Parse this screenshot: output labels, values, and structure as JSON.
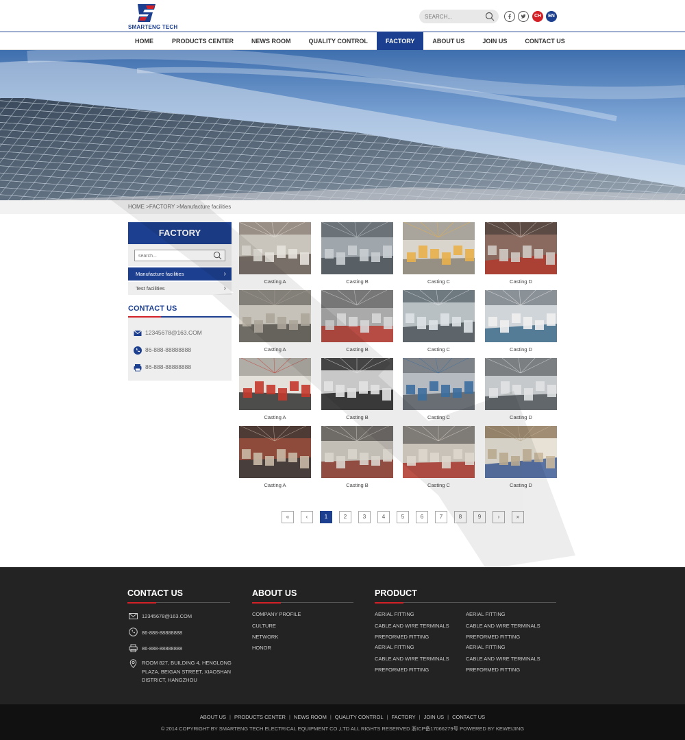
{
  "header": {
    "logo_text": "SMARTENG TECH",
    "search_placeholder": "SEARCH...",
    "lang_ch": "CH",
    "lang_en": "EN"
  },
  "nav": {
    "items": [
      "HOME",
      "PRODUCTS CENTER",
      "NEWS ROOM",
      "QUALITY CONTROL",
      "FACTORY",
      "ABOUT US",
      "JOIN US",
      "CONTACT US"
    ],
    "active": "FACTORY"
  },
  "breadcrumb": "HOME >FACTORY >Manufacture facilities",
  "sidebar": {
    "title": "FACTORY",
    "search_placeholder": "search...",
    "items": [
      "Manufacture facilities",
      "Test facilities"
    ],
    "contact_title": "CONTACT US",
    "email": "12345678@163.COM",
    "phone": "86-888-88888888",
    "fax": "86-888-88888888"
  },
  "gallery": {
    "rows": [
      [
        "Casting A",
        "Casting B",
        "Casting C",
        "Casting D"
      ],
      [
        "Casting A",
        "Casting B",
        "Casting C",
        "Casting D"
      ],
      [
        "Casting A",
        "Casting B",
        "Casting C",
        "Casting D"
      ],
      [
        "Casting A",
        "Casting B",
        "Casting C",
        "Casting D"
      ]
    ]
  },
  "pagination": {
    "first": "«",
    "prev": "‹",
    "pages": [
      "1",
      "2",
      "3",
      "4",
      "5",
      "6",
      "7",
      "8",
      "9"
    ],
    "current": "1",
    "next": "›",
    "last": "»"
  },
  "footer": {
    "contact_title": "CONTACT US",
    "email": "12345678@163.COM",
    "phone": "86-888-88888888",
    "fax": "86-888-88888888",
    "address": "ROOM 827, BUILDING 4, HENGLONG PLAZA, BEIGAN STREET, XIAOSHAN DISTRICT, HANGZHOU",
    "about_title": "ABOUT US",
    "about_items": [
      "COMPANY PROFILE",
      "CULTURE",
      "NETWORK",
      "HONOR"
    ],
    "product_title": "PRODUCT",
    "product_col1": [
      "AERIAL FITTING",
      "CABLE AND WIRE TERMINALS",
      "PREFORMED FITTING",
      "AERIAL FITTING",
      "CABLE AND WIRE TERMINALS",
      "PREFORMED FITTING"
    ],
    "product_col2": [
      "AERIAL FITTING",
      "CABLE AND WIRE TERMINALS",
      "PREFORMED FITTING",
      "AERIAL FITTING",
      "CABLE AND WIRE TERMINALS",
      "PREFORMED FITTING"
    ],
    "bottom_links": [
      "ABOUT US",
      "PRODUCTS CENTER",
      "NEWS ROOM",
      "QUALITY CONTROL",
      "FACTORY",
      "JOIN US",
      "CONTACT US"
    ],
    "copyright": "© 2014 COPYRIGHT BY SMARTENG TECH ELECTRICAL EQUIPMENT CO.,LTD ALL RIGHTS RESERVED 浙ICP备17066279号  POWERED BY KEWEIJING"
  },
  "colors": {
    "brand_blue": "#1d3f8f",
    "brand_red": "#d42027",
    "footer_bg": "#232323"
  }
}
